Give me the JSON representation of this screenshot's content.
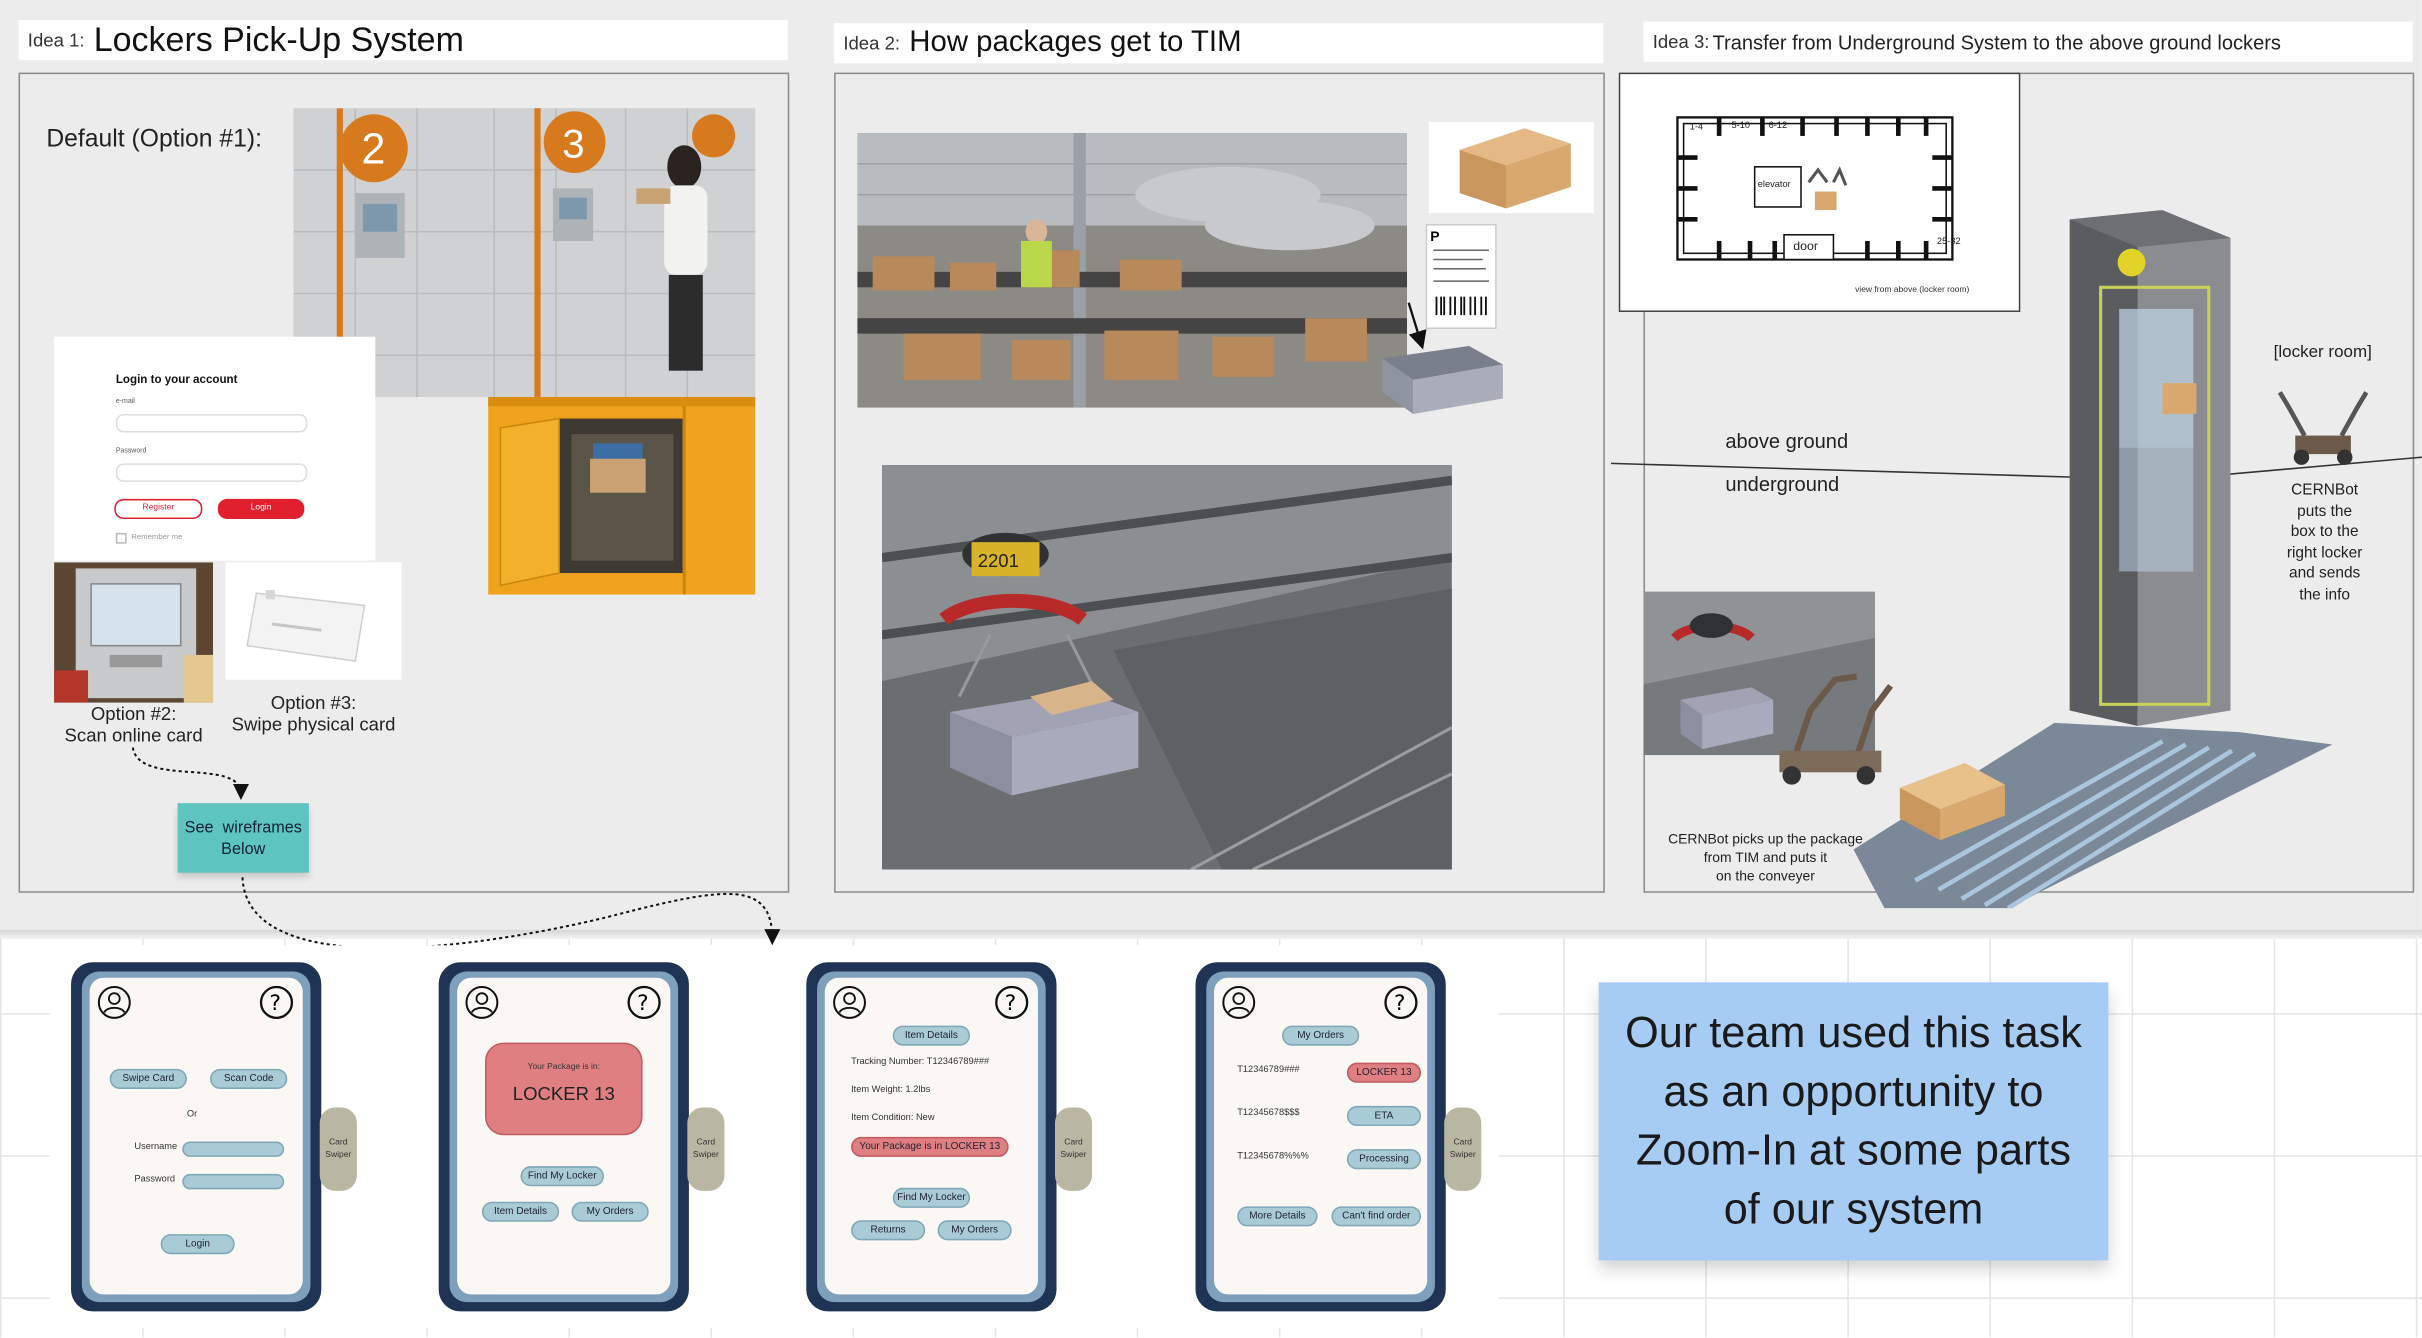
{
  "ideas": {
    "idea1": {
      "prefix": "Idea 1:",
      "title": "Lockers Pick-Up System",
      "default_label": "Default (Option #1):",
      "opt2_caption": "Option #2:\nScan online card",
      "opt3_caption": "Option #3:\nSwipe physical card",
      "note": "See  wireframes\nBelow"
    },
    "idea2": {
      "prefix": "Idea 2:",
      "title": "How packages get to TIM",
      "carrier_number": "2201"
    },
    "idea3": {
      "prefix": "Idea 3:",
      "title": "Transfer from Underground System to the above ground lockers",
      "above": "above ground",
      "under": "underground",
      "locker_room": "[locker room]",
      "cernbot_right": "CERNBot\nputs the\nbox to the\nright locker\nand sends\nthe info",
      "cernbot_left": "CERNBot picks up the package\nfrom TIM and puts it\non the conveyer",
      "view_caption": "view from above (locker room)"
    }
  },
  "login_form": {
    "title": "Login to your account",
    "email_label": "e-mail",
    "password_label": "Password",
    "register": "Register",
    "login": "Login",
    "remember": "Remember me"
  },
  "locker_plan": {
    "labels": [
      "1-4",
      "5-10",
      "6-12",
      "25-32"
    ],
    "elevator": "elevator",
    "door": "door"
  },
  "wireframes": {
    "w1": {
      "swipe": "Swipe Card",
      "scan": "Scan Code",
      "or": "Or",
      "username": "Username",
      "password": "Password",
      "login": "Login"
    },
    "w2": {
      "line1": "Your Package is in:",
      "line2": "LOCKER 13",
      "find": "Find My Locker",
      "details": "Item Details",
      "orders": "My Orders"
    },
    "w3": {
      "header": "Item Details",
      "tracking": "Tracking Number: T12346789###",
      "weight": "Item Weight: 1.2lbs",
      "condition": "Item Condition: New",
      "alert": "Your Package is in LOCKER 13",
      "find": "Find My Locker",
      "returns": "Returns",
      "orders": "My Orders"
    },
    "w4": {
      "header": "My Orders",
      "rows": [
        {
          "id": "T12346789###",
          "status": "LOCKER 13"
        },
        {
          "id": "T12345678$$$",
          "status": "ETA"
        },
        {
          "id": "T12345678%%%",
          "status": "Processing"
        }
      ],
      "more": "More Details",
      "cant": "Can't find order"
    },
    "swiper": "Card\nSwiper"
  },
  "sticky_note": "Our team used this task as an opportunity to Zoom-In at some parts of our system",
  "colors": {
    "teal_note": "#5ec4c0",
    "blue_note": "#a7ccf4",
    "phone_dark": "#1f3355",
    "pill": "#a9cbd6",
    "locker_red": "#e07f82",
    "btn_red": "#e0202f"
  }
}
